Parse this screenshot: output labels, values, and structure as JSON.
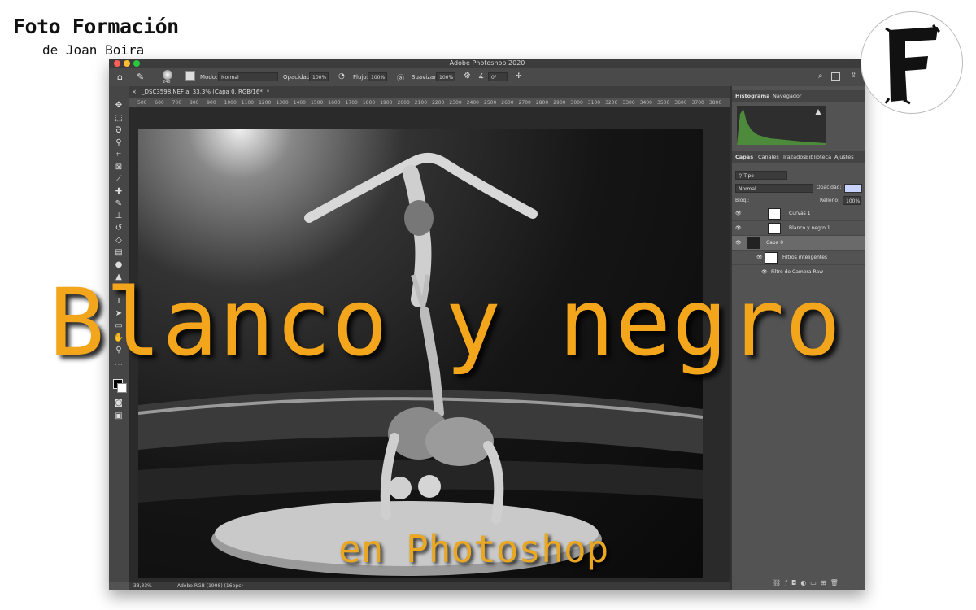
{
  "brand": {
    "title": "Foto Formación",
    "subtitle": "de Joan Boira",
    "logo_letter": "F"
  },
  "app": {
    "window_title": "Adobe Photoshop 2020",
    "options": {
      "brush_size": "240",
      "mode_label": "Modo:",
      "mode_value": "Normal",
      "opacity_label": "Opacidad:",
      "opacity_value": "100%",
      "flow_label": "Flujo:",
      "flow_value": "100%",
      "smooth_label": "Suavizar:",
      "smooth_value": "100%",
      "angle_value": "0°"
    },
    "document_tab": "_DSC3598.NEF al 33,3% (Capa 0, RGB/16*) *",
    "ruler_ticks": [
      "500",
      "600",
      "700",
      "800",
      "900",
      "1000",
      "1100",
      "1200",
      "1300",
      "1400",
      "1500",
      "1600",
      "1700",
      "1800",
      "1900",
      "2000",
      "2100",
      "2200",
      "2300",
      "2400",
      "2500",
      "2600",
      "2700",
      "2800",
      "2900",
      "3000",
      "3100",
      "3200",
      "3300",
      "3400",
      "3500",
      "3600",
      "3700",
      "3800"
    ],
    "status": {
      "zoom": "33,33%",
      "profile": "Adobe RGB (1998) (16bpc)"
    }
  },
  "panels": {
    "top_tabs": [
      "Histograma",
      "Navegador"
    ],
    "layer_tabs": [
      "Capas",
      "Canales",
      "Trazados",
      "Biblioteca",
      "Ajustes"
    ],
    "filter_kind": "Tipo",
    "blend_mode": "Normal",
    "opacity_label": "Opacidad:",
    "lock_label": "Bloq.:",
    "fill_label": "Relleno:",
    "fill_value": "100%",
    "layers": [
      {
        "name": "Curvas 1"
      },
      {
        "name": "Blanco y negro 1"
      },
      {
        "name": "Capa 0"
      },
      {
        "name": "Filtros inteligentes"
      },
      {
        "name": "Filtro de Camera Raw"
      }
    ]
  },
  "overlay": {
    "title": "Blanco y negro",
    "subtitle": "en Photoshop"
  },
  "colors": {
    "accent": "#f3a61c",
    "ui_bg": "#535353"
  }
}
